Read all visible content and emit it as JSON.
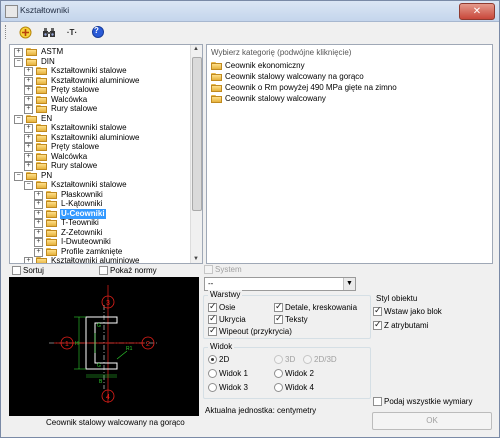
{
  "window": {
    "title": "Kształtowniki",
    "close_glyph": "✕"
  },
  "toolbar": {
    "icons": [
      "add-icon",
      "find-icon",
      "text-tool-icon",
      "help-icon"
    ],
    "text_tool_glyph": "·T·",
    "help_glyph": "?"
  },
  "tree": {
    "rows": [
      {
        "label": "ASTM",
        "level": 0,
        "expander": "+"
      },
      {
        "label": "DIN",
        "level": 0,
        "expander": "−"
      },
      {
        "label": "Kształtowniki stalowe",
        "level": 1,
        "expander": "+"
      },
      {
        "label": "Kształtowniki aluminiowe",
        "level": 1,
        "expander": "+"
      },
      {
        "label": "Pręty stalowe",
        "level": 1,
        "expander": "+"
      },
      {
        "label": "Walcówka",
        "level": 1,
        "expander": "+"
      },
      {
        "label": "Rury stalowe",
        "level": 1,
        "expander": "+"
      },
      {
        "label": "EN",
        "level": 0,
        "expander": "−"
      },
      {
        "label": "Kształtowniki stalowe",
        "level": 1,
        "expander": "+"
      },
      {
        "label": "Kształtowniki aluminiowe",
        "level": 1,
        "expander": "+"
      },
      {
        "label": "Pręty stalowe",
        "level": 1,
        "expander": "+"
      },
      {
        "label": "Walcówka",
        "level": 1,
        "expander": "+"
      },
      {
        "label": "Rury stalowe",
        "level": 1,
        "expander": "+"
      },
      {
        "label": "PN",
        "level": 0,
        "expander": "−"
      },
      {
        "label": "Kształtowniki stalowe",
        "level": 1,
        "expander": "−"
      },
      {
        "label": "Płaskowniki",
        "level": 2,
        "expander": "+"
      },
      {
        "label": "L-Kątowniki",
        "level": 2,
        "expander": "+"
      },
      {
        "label": "U-Ceowniki",
        "level": 2,
        "expander": "+",
        "selected": true
      },
      {
        "label": "T-Teowniki",
        "level": 2,
        "expander": "+"
      },
      {
        "label": "Z-Zetowniki",
        "level": 2,
        "expander": "+"
      },
      {
        "label": "I-Dwuteowniki",
        "level": 2,
        "expander": "+"
      },
      {
        "label": "Profile zamknięte",
        "level": 2,
        "expander": "+"
      },
      {
        "label": "Kształtowniki aluminiowe",
        "level": 1,
        "expander": "+"
      }
    ]
  },
  "categories": {
    "header": "Wybierz kategorię (podwójne kliknięcie)",
    "items": [
      "Ceownik ekonomiczny",
      "Ceownik stalowy walcowany na gorąco",
      "Ceownik o Rm powyżej 490 MPa gięte na zimno",
      "Ceownik stalowy walcowany"
    ]
  },
  "options": {
    "sortuj": "Sortuj",
    "pokaz_normy": "Pokaż normy",
    "system": "System",
    "combo_value": "--"
  },
  "preview": {
    "caption": "Ceownik stalowy walcowany na gorąco",
    "markers": [
      "1",
      "2",
      "3",
      "4"
    ],
    "dim_letters": [
      "G",
      "G",
      "H",
      "B",
      "R1"
    ]
  },
  "warstwy": {
    "title": "Warstwy",
    "items": [
      {
        "label": "Osie",
        "checked": true
      },
      {
        "label": "Detale, kreskowania",
        "checked": true
      },
      {
        "label": "Ukrycia",
        "checked": true
      },
      {
        "label": "Teksty",
        "checked": true
      },
      {
        "label": "Wipeout (przykrycia)",
        "checked": true
      }
    ]
  },
  "widok": {
    "title": "Widok",
    "items": [
      {
        "label": "2D",
        "selected": true,
        "enabled": true
      },
      {
        "label": "3D",
        "selected": false,
        "enabled": false
      },
      {
        "label": "2D/3D",
        "selected": false,
        "enabled": false
      },
      {
        "label": "Widok 1",
        "selected": false,
        "enabled": true
      },
      {
        "label": "Widok 2",
        "selected": false,
        "enabled": true
      },
      {
        "label": "Widok 3",
        "selected": false,
        "enabled": true
      },
      {
        "label": "Widok 4",
        "selected": false,
        "enabled": true
      }
    ]
  },
  "styl": {
    "title": "Styl obiektu",
    "items": [
      {
        "label": "Wstaw jako blok",
        "checked": true
      },
      {
        "label": "Z atrybutami",
        "checked": true
      }
    ]
  },
  "footer": {
    "podaj": "Podaj wszystkie wymiary",
    "jednostka": "Aktualna jednostka: centymetry",
    "ok": "OK"
  },
  "colors": {
    "selection": "#3399ff",
    "preview_bg": "#000000",
    "marker_red": "#e8201a",
    "profile_white": "#ffffff",
    "dim_green": "#2fd02f"
  }
}
